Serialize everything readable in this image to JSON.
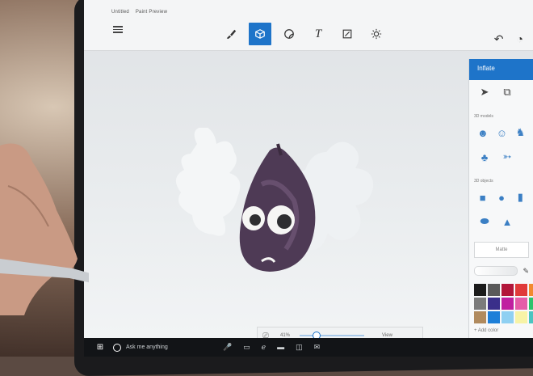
{
  "window": {
    "title": "Untitled",
    "subtitle": "Paint Preview"
  },
  "toolbar": {
    "tools": [
      {
        "name": "brushes",
        "icon": "brush-icon",
        "active": false
      },
      {
        "name": "3d-objects",
        "icon": "cube-icon",
        "active": true
      },
      {
        "name": "stickers",
        "icon": "sticker-icon",
        "active": false
      },
      {
        "name": "text",
        "icon": "text-icon",
        "label": "T",
        "active": false
      },
      {
        "name": "canvas",
        "icon": "canvas-resize-icon",
        "active": false
      },
      {
        "name": "effects",
        "icon": "sun-effects-icon",
        "active": false
      }
    ],
    "right": [
      "undo-icon",
      "history-icon"
    ]
  },
  "panel": {
    "title": "Inflate",
    "section_models": "3D models",
    "section_objects": "3D objects",
    "material": "Matte",
    "add_color": "+ Add color",
    "palette": [
      "#1b1b1b",
      "#5a5a5a",
      "#b2163a",
      "#e03a3a",
      "#f28a2e",
      "#f5d02a",
      "#7b7b7b",
      "#3a2f8a",
      "#c01fa0",
      "#e55ca8",
      "#2cc36b",
      "#9ee24a",
      "#b08a5e",
      "#1e7fd8",
      "#8fd0f2",
      "#f7f3a6",
      "#4bc4c0",
      "#b7f0e4"
    ]
  },
  "zoom": {
    "percent": "41%",
    "view_label": "View",
    "level": 0.25
  },
  "taskbar": {
    "search_placeholder": "Ask me anything"
  },
  "colors": {
    "accent": "#1e74c9",
    "taskbar": "#121417"
  }
}
